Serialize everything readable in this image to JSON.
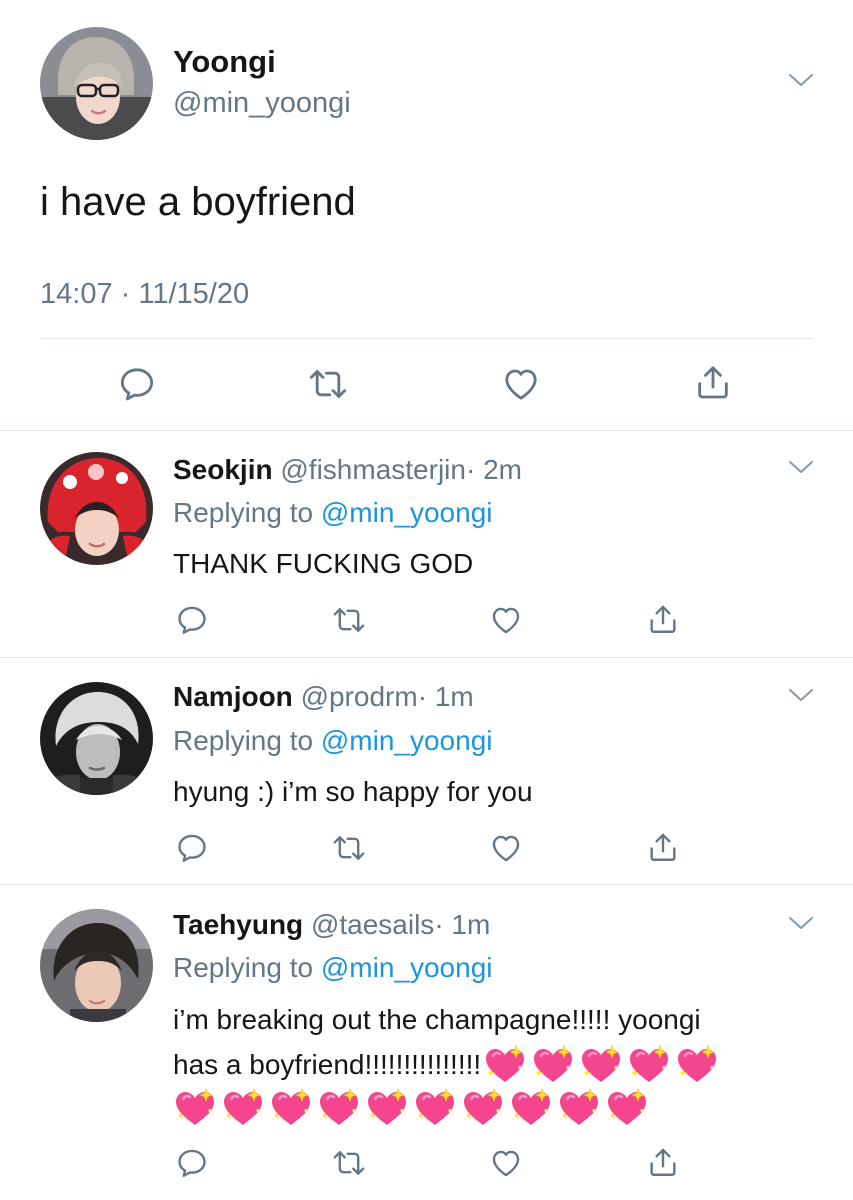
{
  "main_tweet": {
    "display_name": "Yoongi",
    "handle": "@min_yoongi",
    "text": "i have a boyfriend",
    "timestamp": "14:07 · 11/15/20"
  },
  "replies": [
    {
      "display_name": "Seokjin",
      "handle": "@fishmasterjin",
      "time": "· 2m",
      "replying_prefix": "Replying to",
      "replying_handle": "@min_yoongi",
      "text": "THANK FUCKING GOD"
    },
    {
      "display_name": "Namjoon",
      "handle": "@prodrm",
      "time": "· 1m",
      "replying_prefix": "Replying to",
      "replying_handle": "@min_yoongi",
      "text": "hyung :) i’m so happy for you"
    },
    {
      "display_name": "Taehyung",
      "handle": "@taesails",
      "time": "· 1m",
      "replying_prefix": "Replying to",
      "replying_handle": "@min_yoongi",
      "text_line1": "i’m breaking out the champagne!!!!! yoongi",
      "text_line2": "has a boyfriend!!!!!!!!!!!!!!!",
      "emoji_line2_count": 5,
      "emoji_line3_count": 10,
      "emoji": "sparkling-heart"
    }
  ],
  "icons": [
    "chevron-down-icon",
    "reply-icon",
    "retweet-icon",
    "like-icon",
    "share-icon"
  ],
  "colors": {
    "text": "#14171a",
    "secondary": "#657786",
    "link": "#1b95e0",
    "divider": "#e1e8ed",
    "heart_emoji": "#f4468f"
  }
}
